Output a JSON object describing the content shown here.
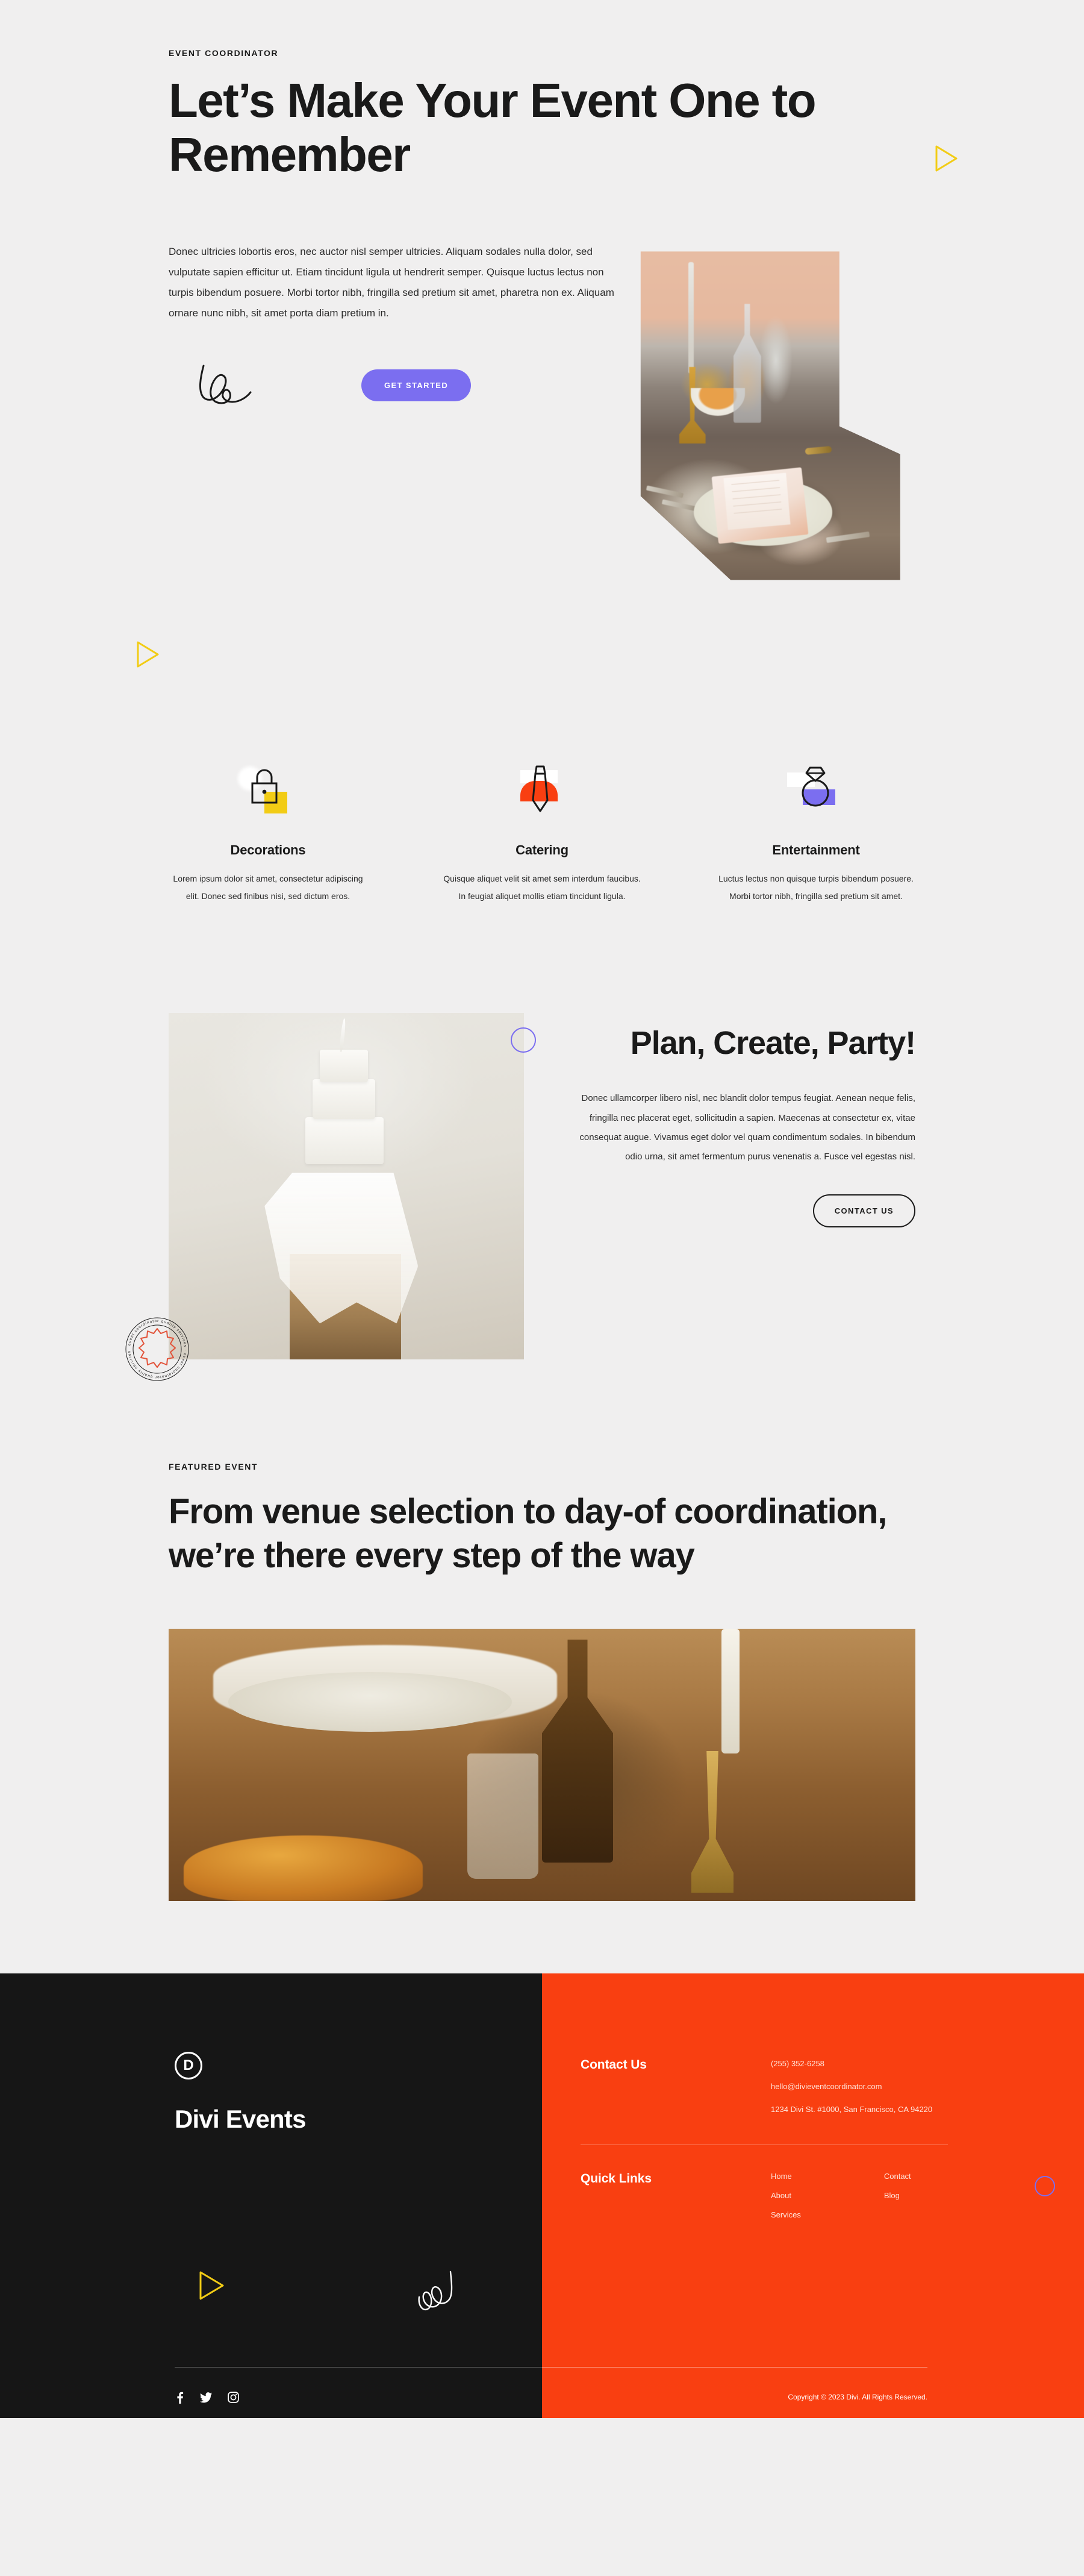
{
  "hero": {
    "eyebrow": "EVENT COORDINATOR",
    "title": "Let’s Make Your Event One to Remember",
    "paragraph": "Donec ultricies lobortis eros, nec auctor nisl semper ultricies. Aliquam sodales nulla dolor, sed vulputate sapien efficitur ut. Etiam tincidunt ligula ut hendrerit semper. Quisque luctus lectus non turpis bibendum posuere. Morbi tortor nibh, fringilla sed pretium sit amet, pharetra non ex. Aliquam ornare nunc nibh, sit amet porta diam pretium in.",
    "cta_label": "GET STARTED",
    "signature_icon": "handwritten-signature-icon",
    "photo_alt_icon": "table-setting-photo",
    "decor_triangle_icon": "triangle-outline-icon"
  },
  "features": [
    {
      "icon": "padlock-icon",
      "accent": "#f2cc15",
      "title": "Decorations",
      "text": "Lorem ipsum dolor sit amet, consectetur adipiscing elit. Donec sed finibus nisi, sed dictum eros."
    },
    {
      "icon": "necktie-icon",
      "accent": "#f93f11",
      "title": "Catering",
      "text": "Quisque aliquet velit sit amet sem interdum faucibus. In feugiat aliquet mollis etiam tincidunt ligula."
    },
    {
      "icon": "diamond-ring-icon",
      "accent": "#7b6ef0",
      "title": "Entertainment",
      "text": "Luctus lectus non quisque turpis bibendum posuere. Morbi tortor nibh, fringilla sed pretium sit amet."
    }
  ],
  "plan": {
    "title": "Plan, Create, Party!",
    "paragraph": "Donec ullamcorper libero nisl, nec blandit dolor tempus feugiat. Aenean neque felis, fringilla nec placerat eget, sollicitudin a sapien. Maecenas at consectetur ex, vitae consequat augue. Vivamus eget dolor vel quam condimentum sodales. In bibendum odio urna, sit amet fermentum purus venenatis a. Fusce vel egestas nisl.",
    "cta_label": "CONTACT US",
    "photo_alt_icon": "wedding-cake-photo",
    "stamp_text": "event coordinator quality services · event coordinator quality services ·",
    "ring_icon": "circle-outline-icon"
  },
  "featured": {
    "eyebrow": "FEATURED EVENT",
    "title": "From venue selection to day-of coordination, we’re there every step of the way",
    "photo_alt_icon": "rustic-table-photo"
  },
  "footer": {
    "brand_mark": "D",
    "brand_name": "Divi Events",
    "contact": {
      "heading": "Contact Us",
      "phone": "(255) 352-6258",
      "email": "hello@divieventcoordinator.com",
      "address": "1234 Divi St. #1000, San Francisco, CA 94220"
    },
    "quick_links": {
      "heading": "Quick Links",
      "column_one": [
        "Home",
        "About",
        "Services"
      ],
      "column_two": [
        "Contact",
        "Blog"
      ]
    },
    "socials": [
      {
        "icon": "facebook-icon",
        "label": "Facebook"
      },
      {
        "icon": "twitter-icon",
        "label": "Twitter"
      },
      {
        "icon": "instagram-icon",
        "label": "Instagram"
      }
    ],
    "copyright": "Copyright © 2023 Divi. All Rights Reserved.",
    "decor_triangle_icon": "triangle-outline-icon",
    "decor_squiggle_icon": "script-squiggle-icon",
    "decor_ring_icon": "circle-outline-icon"
  },
  "colors": {
    "background": "#f0efef",
    "ink": "#1a1a1a",
    "purple": "#7b6ef0",
    "orange": "#f93f11",
    "yellow": "#f2cc15",
    "footer_dark": "#161616"
  }
}
